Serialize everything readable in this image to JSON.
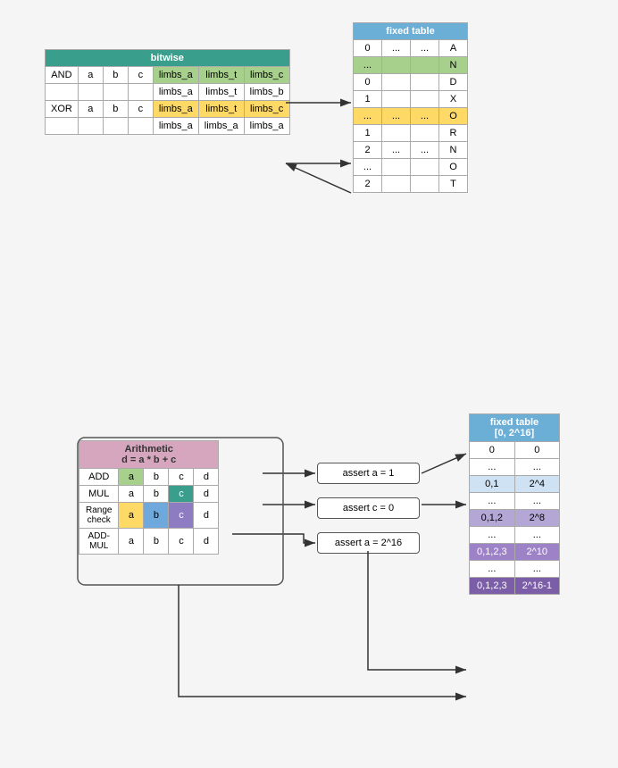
{
  "top": {
    "bitwise": {
      "title": "bitwise",
      "rows": [
        [
          "AND",
          "a",
          "b",
          "c",
          "limbs_a",
          "limbs_t",
          "limbs_c"
        ],
        [
          "",
          "",
          "",
          "",
          "limbs_a",
          "limbs_t",
          "limbs_b"
        ],
        [
          "XOR",
          "a",
          "b",
          "c",
          "limbs_a",
          "limbs_t",
          "limbs_c"
        ],
        [
          "",
          "",
          "",
          "",
          "limbs_a",
          "limbs_a",
          "limbs_a"
        ]
      ]
    },
    "fixed_table": {
      "title": "fixed table",
      "headers": [
        "0",
        "...",
        "...",
        "A"
      ],
      "rows": [
        [
          "...",
          "",
          "",
          "N"
        ],
        [
          "0",
          "",
          "",
          "D"
        ],
        [
          "1",
          "",
          "",
          "X"
        ],
        [
          "...",
          "...",
          "...",
          "O"
        ],
        [
          "1",
          "",
          "",
          "R"
        ],
        [
          "2",
          "...",
          "...",
          "N"
        ],
        [
          "...",
          "",
          "",
          "O"
        ],
        [
          "2",
          "",
          "",
          "T"
        ]
      ]
    }
  },
  "bottom": {
    "arithmetic": {
      "title": "Arithmetic",
      "subtitle": "d = a * b + c",
      "rows": [
        [
          "ADD",
          "a",
          "b",
          "c",
          "d"
        ],
        [
          "MUL",
          "a",
          "b",
          "c",
          "d"
        ],
        [
          "Range\ncheck",
          "a",
          "b",
          "c",
          "d"
        ],
        [
          "ADD-\nMUL",
          "a",
          "b",
          "c",
          "d"
        ]
      ]
    },
    "asserts": [
      "assert a = 1",
      "assert c = 0",
      "assert a = 2^16"
    ],
    "fixed_table": {
      "title": "fixed table\n[0, 2^16]",
      "rows": [
        [
          "0",
          "0"
        ],
        [
          "...",
          "..."
        ],
        [
          "0,1",
          "2^4"
        ],
        [
          "...",
          "..."
        ],
        [
          "0,1,2",
          "2^8"
        ],
        [
          "...",
          "..."
        ],
        [
          "0,1,2,3",
          "2^10"
        ],
        [
          "...",
          "..."
        ],
        [
          "0,1,2,3",
          "2^16-1"
        ]
      ]
    }
  }
}
